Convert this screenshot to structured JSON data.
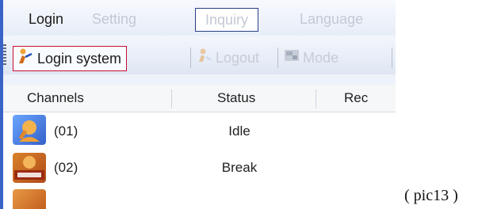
{
  "menu": {
    "items": [
      {
        "label": "Login",
        "state": "active"
      },
      {
        "label": "Setting",
        "state": "disabled"
      },
      {
        "label": "Inquiry",
        "state": "disabled-selected"
      },
      {
        "label": "Language",
        "state": "disabled"
      }
    ]
  },
  "toolbar": {
    "login_label": "Login system",
    "logout_label": "Logout",
    "mode_label": "Mode"
  },
  "grid": {
    "columns": [
      "Channels",
      "Status",
      "Rec"
    ],
    "rows": [
      {
        "channel": "(01)",
        "status": "Idle",
        "rec": ""
      },
      {
        "channel": "(02)",
        "status": "Break",
        "rec": ""
      }
    ]
  },
  "caption": "( pic13 )",
  "colors": {
    "accent_blue": "#3a63c7",
    "login_highlight": "#c8102e",
    "inquiry_box": "#2a3f86"
  },
  "icons": [
    "agent-login-icon",
    "logout-icon",
    "mode-icon",
    "agent-avatar-icon",
    "no-line-avatar-icon"
  ]
}
